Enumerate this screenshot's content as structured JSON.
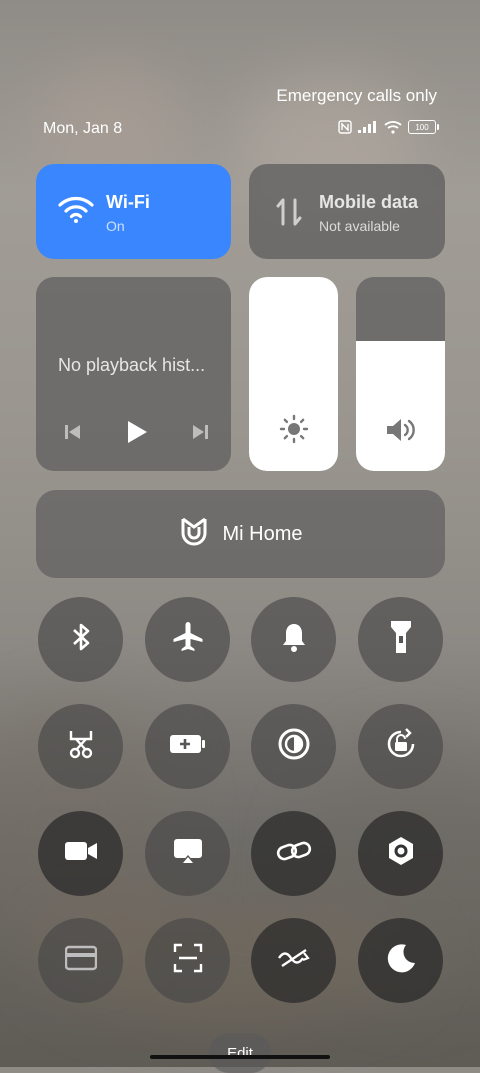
{
  "status": {
    "carrier_text": "Emergency calls only",
    "date": "Mon, Jan 8",
    "battery": "100",
    "icons": [
      "nfc-icon",
      "signal-icon",
      "wifi-icon",
      "battery-icon"
    ]
  },
  "tiles": {
    "wifi": {
      "title": "Wi-Fi",
      "subtitle": "On",
      "icon": "wifi-icon",
      "color": "#3a86ff"
    },
    "mobile": {
      "title": "Mobile data",
      "subtitle": "Not available",
      "icon": "mobile-data-icon"
    }
  },
  "media": {
    "text": "No playback hist...",
    "controls": [
      "previous-icon",
      "play-icon",
      "next-icon"
    ]
  },
  "sliders": {
    "brightness": {
      "icon": "brightness-icon",
      "level": 1.0
    },
    "volume": {
      "icon": "volume-icon",
      "level": 0.67
    }
  },
  "mi_home": {
    "label": "Mi Home",
    "icon": "mi-home-icon"
  },
  "toggles": [
    {
      "name": "bluetooth",
      "icon": "bluetooth-icon"
    },
    {
      "name": "airplane",
      "icon": "airplane-icon"
    },
    {
      "name": "sound",
      "icon": "bell-icon"
    },
    {
      "name": "flashlight",
      "icon": "flashlight-icon"
    },
    {
      "name": "screenshot",
      "icon": "scissors-icon"
    },
    {
      "name": "battery-saver",
      "icon": "battery-saver-icon"
    },
    {
      "name": "dark-mode",
      "icon": "contrast-icon"
    },
    {
      "name": "rotation-lock",
      "icon": "rotation-lock-icon"
    },
    {
      "name": "screen-recorder",
      "icon": "video-icon"
    },
    {
      "name": "cast",
      "icon": "cast-icon"
    },
    {
      "name": "link",
      "icon": "link-icon"
    },
    {
      "name": "settings",
      "icon": "hexagon-icon"
    },
    {
      "name": "card",
      "icon": "card-icon"
    },
    {
      "name": "scanner",
      "icon": "scan-icon"
    },
    {
      "name": "sync",
      "icon": "sync-icon"
    },
    {
      "name": "do-not-disturb",
      "icon": "moon-icon"
    }
  ],
  "edit_label": "Edit"
}
